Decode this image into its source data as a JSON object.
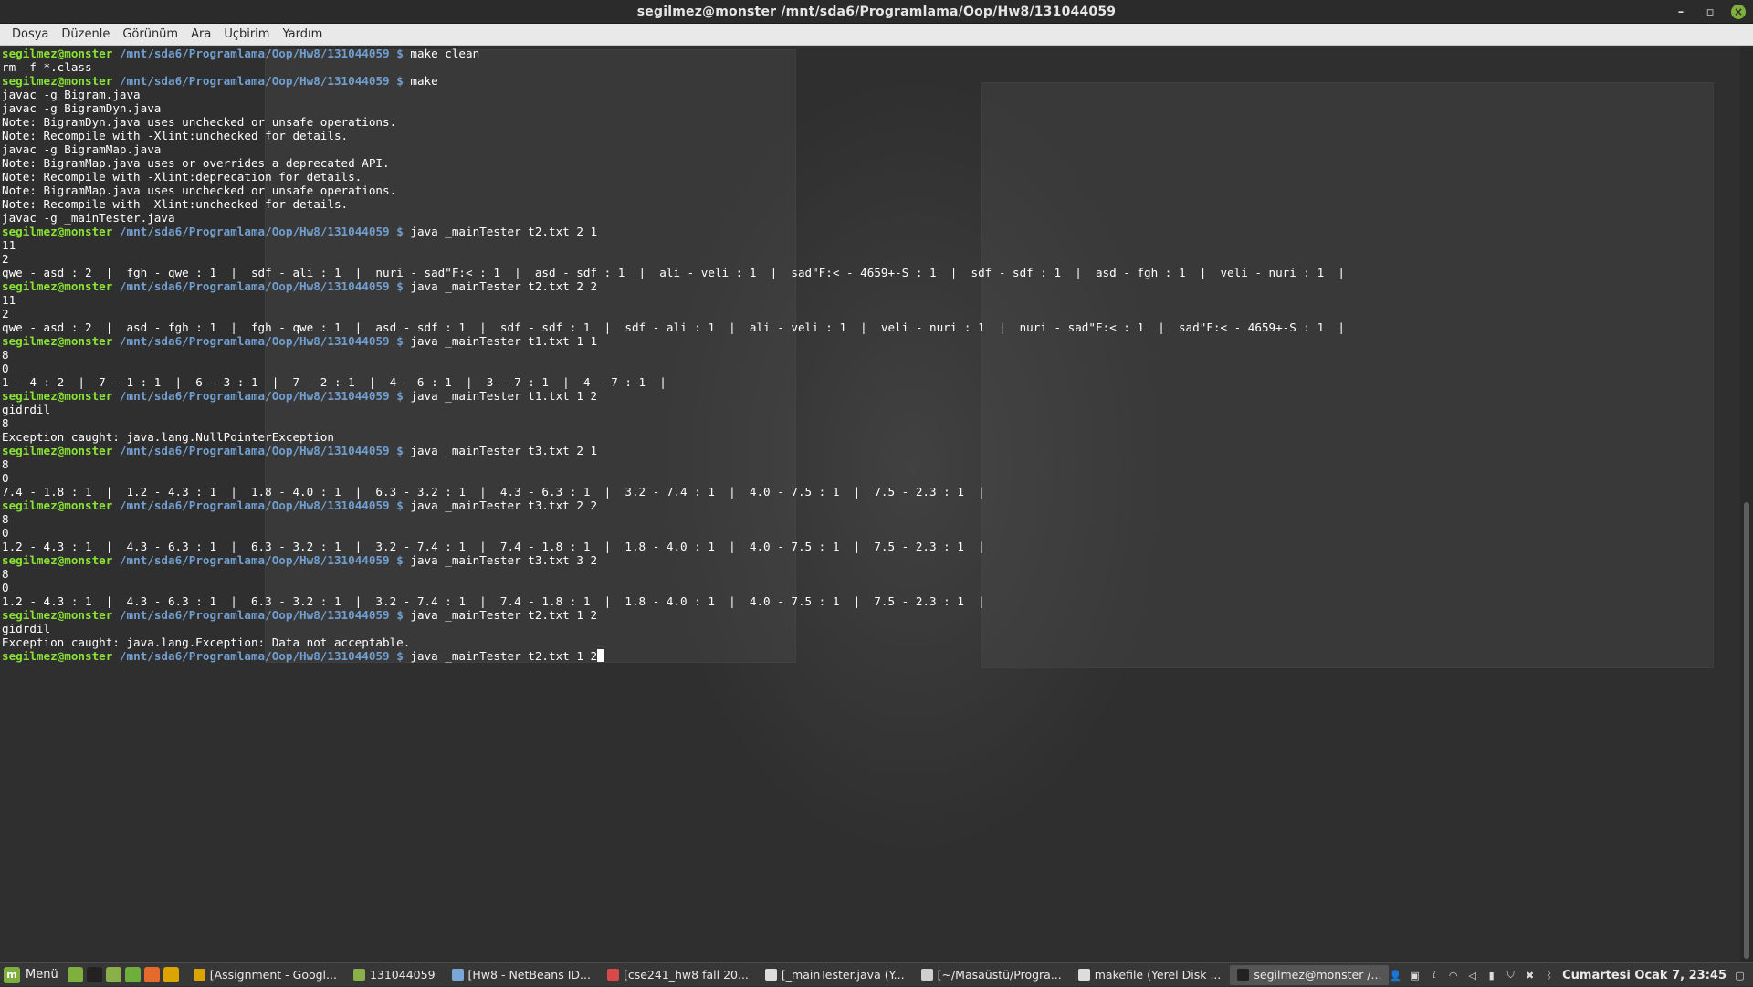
{
  "window": {
    "title": "segilmez@monster /mnt/sda6/Programlama/Oop/Hw8/131044059",
    "controls": {
      "minimize": "–",
      "maximize": "▫",
      "close": "×"
    }
  },
  "menubar": [
    "Dosya",
    "Düzenle",
    "Görünüm",
    "Ara",
    "Uçbirim",
    "Yardım"
  ],
  "terminal": {
    "prompt_user": "segilmez@monster",
    "prompt_path": " /mnt/sda6/Programlama/Oop/Hw8/131044059 $ ",
    "lines": [
      {
        "type": "prompt",
        "cmd": "make clean"
      },
      {
        "type": "out",
        "text": "rm -f *.class"
      },
      {
        "type": "prompt",
        "cmd": "make"
      },
      {
        "type": "out",
        "text": "javac -g Bigram.java"
      },
      {
        "type": "out",
        "text": "javac -g BigramDyn.java"
      },
      {
        "type": "out",
        "text": "Note: BigramDyn.java uses unchecked or unsafe operations."
      },
      {
        "type": "out",
        "text": "Note: Recompile with -Xlint:unchecked for details."
      },
      {
        "type": "out",
        "text": "javac -g BigramMap.java"
      },
      {
        "type": "out",
        "text": "Note: BigramMap.java uses or overrides a deprecated API."
      },
      {
        "type": "out",
        "text": "Note: Recompile with -Xlint:deprecation for details."
      },
      {
        "type": "out",
        "text": "Note: BigramMap.java uses unchecked or unsafe operations."
      },
      {
        "type": "out",
        "text": "Note: Recompile with -Xlint:unchecked for details."
      },
      {
        "type": "out",
        "text": "javac -g _mainTester.java"
      },
      {
        "type": "prompt",
        "cmd": "java _mainTester t2.txt 2 1"
      },
      {
        "type": "out",
        "text": "11"
      },
      {
        "type": "out",
        "text": "2"
      },
      {
        "type": "out",
        "text": "qwe - asd : 2  |  fgh - qwe : 1  |  sdf - ali : 1  |  nuri - sad\"F:< : 1  |  asd - sdf : 1  |  ali - veli : 1  |  sad\"F:< - 4659+-S : 1  |  sdf - sdf : 1  |  asd - fgh : 1  |  veli - nuri : 1  |"
      },
      {
        "type": "prompt",
        "cmd": "java _mainTester t2.txt 2 2"
      },
      {
        "type": "out",
        "text": "11"
      },
      {
        "type": "out",
        "text": "2"
      },
      {
        "type": "out",
        "text": "qwe - asd : 2  |  asd - fgh : 1  |  fgh - qwe : 1  |  asd - sdf : 1  |  sdf - sdf : 1  |  sdf - ali : 1  |  ali - veli : 1  |  veli - nuri : 1  |  nuri - sad\"F:< : 1  |  sad\"F:< - 4659+-S : 1  |"
      },
      {
        "type": "prompt",
        "cmd": "java _mainTester t1.txt 1 1"
      },
      {
        "type": "out",
        "text": "8"
      },
      {
        "type": "out",
        "text": "0"
      },
      {
        "type": "out",
        "text": "1 - 4 : 2  |  7 - 1 : 1  |  6 - 3 : 1  |  7 - 2 : 1  |  4 - 6 : 1  |  3 - 7 : 1  |  4 - 7 : 1  |"
      },
      {
        "type": "prompt",
        "cmd": "java _mainTester t1.txt 1 2"
      },
      {
        "type": "out",
        "text": "gidrdil"
      },
      {
        "type": "out",
        "text": "8"
      },
      {
        "type": "out",
        "text": "Exception caught: java.lang.NullPointerException"
      },
      {
        "type": "prompt",
        "cmd": "java _mainTester t3.txt 2 1"
      },
      {
        "type": "out",
        "text": "8"
      },
      {
        "type": "out",
        "text": "0"
      },
      {
        "type": "out",
        "text": "7.4 - 1.8 : 1  |  1.2 - 4.3 : 1  |  1.8 - 4.0 : 1  |  6.3 - 3.2 : 1  |  4.3 - 6.3 : 1  |  3.2 - 7.4 : 1  |  4.0 - 7.5 : 1  |  7.5 - 2.3 : 1  |"
      },
      {
        "type": "prompt",
        "cmd": "java _mainTester t3.txt 2 2"
      },
      {
        "type": "out",
        "text": "8"
      },
      {
        "type": "out",
        "text": "0"
      },
      {
        "type": "out",
        "text": "1.2 - 4.3 : 1  |  4.3 - 6.3 : 1  |  6.3 - 3.2 : 1  |  3.2 - 7.4 : 1  |  7.4 - 1.8 : 1  |  1.8 - 4.0 : 1  |  4.0 - 7.5 : 1  |  7.5 - 2.3 : 1  |"
      },
      {
        "type": "prompt",
        "cmd": "java _mainTester t3.txt 3 2"
      },
      {
        "type": "out",
        "text": "8"
      },
      {
        "type": "out",
        "text": "0"
      },
      {
        "type": "out",
        "text": "1.2 - 4.3 : 1  |  4.3 - 6.3 : 1  |  6.3 - 3.2 : 1  |  3.2 - 7.4 : 1  |  7.4 - 1.8 : 1  |  1.8 - 4.0 : 1  |  4.0 - 7.5 : 1  |  7.5 - 2.3 : 1  |"
      },
      {
        "type": "prompt",
        "cmd": "java _mainTester t2.txt 1 2"
      },
      {
        "type": "out",
        "text": "gidrdil"
      },
      {
        "type": "out",
        "text": "Exception caught: java.lang.Exception: Data not acceptable."
      },
      {
        "type": "prompt",
        "cmd": "java _mainTester t2.txt 1 2",
        "cursor": true
      }
    ]
  },
  "taskbar": {
    "menu_label": "Menü",
    "launchers": [
      {
        "icon": "show-desktop-icon",
        "color": "#7fb03e"
      },
      {
        "icon": "terminal-icon",
        "color": "#222222"
      },
      {
        "icon": "files-icon",
        "color": "#8bb04a"
      },
      {
        "icon": "browser-icon",
        "color": "#6fae3a"
      },
      {
        "icon": "firefox-icon",
        "color": "#e66a2b"
      },
      {
        "icon": "chrome-icon",
        "color": "#dca400"
      }
    ],
    "tasks": [
      {
        "label": "[Assignment - Googl...",
        "icon_color": "#dca400",
        "active": false
      },
      {
        "label": "131044059",
        "icon_color": "#8bb04a",
        "active": false
      },
      {
        "label": "[Hw8 - NetBeans ID...",
        "icon_color": "#7aa7d6",
        "active": false
      },
      {
        "label": "[cse241_hw8 fall 20...",
        "icon_color": "#d84a4a",
        "active": false
      },
      {
        "label": "[_mainTester.java (Y...",
        "icon_color": "#dddddd",
        "active": false
      },
      {
        "label": "[~/Masaüstü/Progra...",
        "icon_color": "#cfcfcf",
        "active": false
      },
      {
        "label": "makefile (Yerel Disk ...",
        "icon_color": "#dddddd",
        "active": false
      },
      {
        "label": "segilmez@monster /...",
        "icon_color": "#222222",
        "active": true
      }
    ],
    "tray": [
      {
        "icon": "user-icon",
        "glyph": "👤"
      },
      {
        "icon": "clipboard-icon",
        "glyph": "▣"
      },
      {
        "icon": "network-icon",
        "glyph": "⟟"
      },
      {
        "icon": "wifi-icon",
        "glyph": "◠"
      },
      {
        "icon": "volume-icon",
        "glyph": "◁"
      },
      {
        "icon": "battery-icon",
        "glyph": "▮"
      },
      {
        "icon": "shield-icon",
        "glyph": "⛉"
      },
      {
        "icon": "update-icon",
        "glyph": "✖"
      },
      {
        "icon": "bluetooth-icon",
        "glyph": "ᛒ"
      }
    ],
    "clock": "Cumartesi Ocak  7, 23:45",
    "notification_glyph": "▢"
  }
}
